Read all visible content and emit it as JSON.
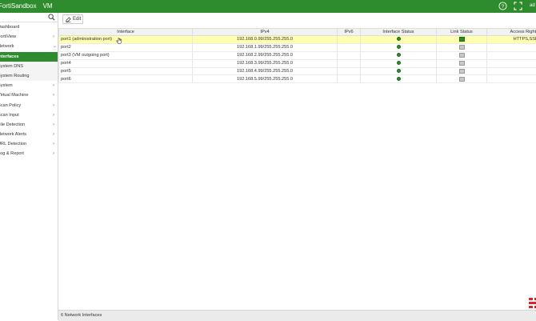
{
  "app": {
    "product": "FortiSandbox",
    "model": "VM",
    "user": "ad"
  },
  "icons": {
    "help": "question-circle-icon",
    "fullscreen": "expand-icon",
    "search": "search-icon",
    "edit": "edit-icon"
  },
  "colors": {
    "brand": "#2e8b2e",
    "selected_row": "#ffffb0"
  },
  "sidebar": {
    "items": [
      {
        "label": "Dashboard",
        "chevron": "",
        "type": "top"
      },
      {
        "label": "FortiView",
        "chevron": "›",
        "type": "top"
      },
      {
        "label": "Network",
        "chevron": "⌄",
        "type": "top"
      },
      {
        "label": "Interfaces",
        "chevron": "",
        "type": "active"
      },
      {
        "label": "System DNS",
        "chevron": "",
        "type": "sub"
      },
      {
        "label": "System Routing",
        "chevron": "",
        "type": "sub"
      },
      {
        "label": "System",
        "chevron": "›",
        "type": "top"
      },
      {
        "label": "Virtual Machine",
        "chevron": "›",
        "type": "top"
      },
      {
        "label": "Scan Policy",
        "chevron": "›",
        "type": "top"
      },
      {
        "label": "Scan Input",
        "chevron": "›",
        "type": "top"
      },
      {
        "label": "File Detection",
        "chevron": "›",
        "type": "top"
      },
      {
        "label": "Network Alerts",
        "chevron": "›",
        "type": "top"
      },
      {
        "label": "URL Detection",
        "chevron": "›",
        "type": "top"
      },
      {
        "label": "Log & Report",
        "chevron": "›",
        "type": "top"
      }
    ]
  },
  "toolbar": {
    "edit_label": "Edit"
  },
  "table": {
    "headers": [
      "Interface",
      "IPv4",
      "IPv6",
      "Interface Status",
      "Link Status",
      "Access Rights"
    ],
    "rows": [
      {
        "interface": "port1 (administration port)",
        "ipv4": "192.168.0.99/255.255.255.0",
        "ipv6": "",
        "interface_status": "up",
        "link_status": "up",
        "access_rights": "HTTPS,SSH",
        "selected": true
      },
      {
        "interface": "port2",
        "ipv4": "192.168.1.99/255.255.255.0",
        "ipv6": "",
        "interface_status": "up",
        "link_status": "down",
        "access_rights": "",
        "selected": false
      },
      {
        "interface": "port3 (VM outgoing port)",
        "ipv4": "192.168.2.99/255.255.255.0",
        "ipv6": "",
        "interface_status": "up",
        "link_status": "down",
        "access_rights": "",
        "selected": false
      },
      {
        "interface": "port4",
        "ipv4": "192.168.3.99/255.255.255.0",
        "ipv6": "",
        "interface_status": "up",
        "link_status": "down",
        "access_rights": "",
        "selected": false
      },
      {
        "interface": "port5",
        "ipv4": "192.168.4.99/255.255.255.0",
        "ipv6": "",
        "interface_status": "up",
        "link_status": "down",
        "access_rights": "",
        "selected": false
      },
      {
        "interface": "port6",
        "ipv4": "192.168.5.99/255.255.255.0",
        "ipv6": "",
        "interface_status": "up",
        "link_status": "down",
        "access_rights": "",
        "selected": false
      }
    ]
  },
  "footer": {
    "count_text": "6 Network Interfaces"
  }
}
